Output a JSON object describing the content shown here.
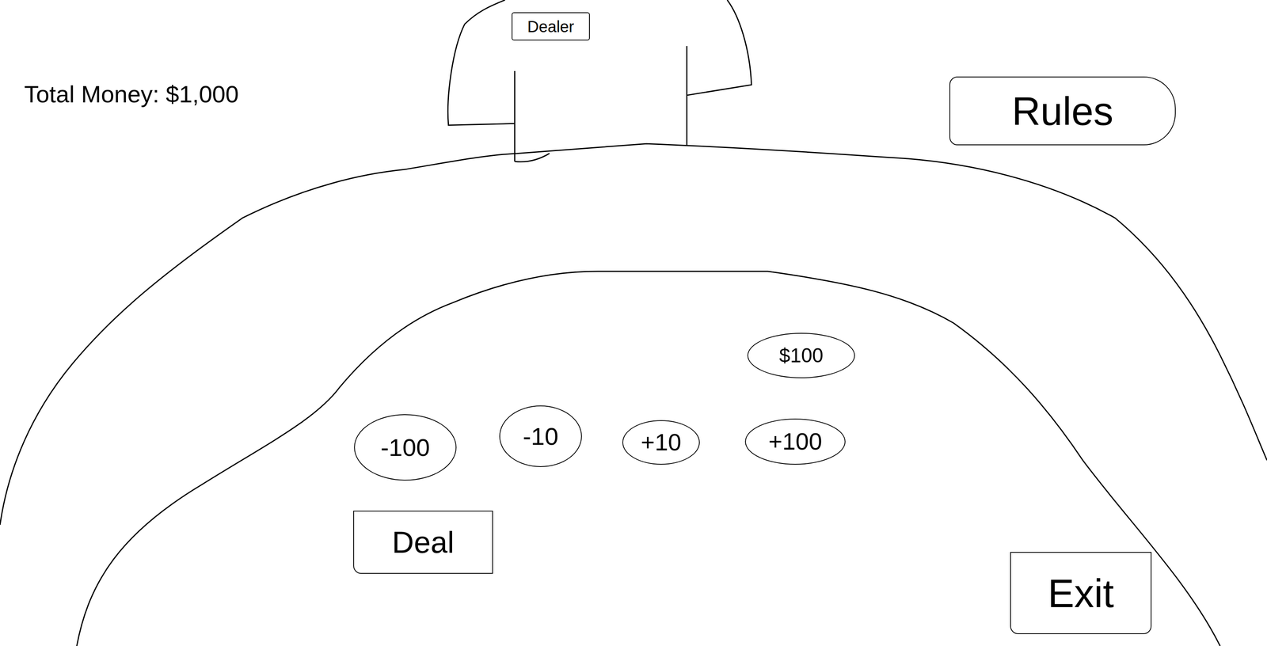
{
  "money": "Total Money: $1,000",
  "dealer": {
    "badge": "Dealer"
  },
  "rules_button": "Rules",
  "bet": "$100",
  "bet_buttons": [
    "-100",
    "-10",
    "+10",
    "+100"
  ],
  "deal_button": "Deal",
  "exit_button": "Exit"
}
